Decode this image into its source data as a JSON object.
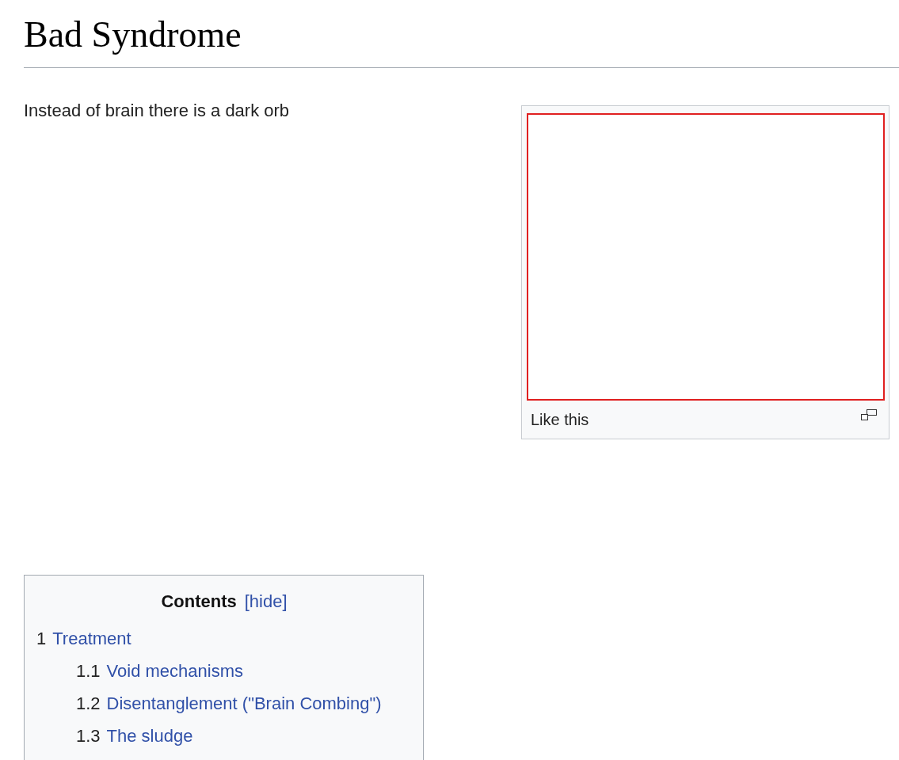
{
  "article": {
    "title": "Bad Syndrome",
    "paragraph": "Instead of brain there is a dark orb"
  },
  "figure": {
    "caption": "Like this"
  },
  "toc": {
    "title": "Contents",
    "toggle": "[hide]",
    "items": [
      {
        "number": "1",
        "label": "Treatment",
        "children": [
          {
            "number": "1.1",
            "label": "Void mechanisms"
          },
          {
            "number": "1.2",
            "label": "Disentanglement (\"Brain Combing\")"
          },
          {
            "number": "1.3",
            "label": "The sludge"
          }
        ]
      }
    ]
  }
}
